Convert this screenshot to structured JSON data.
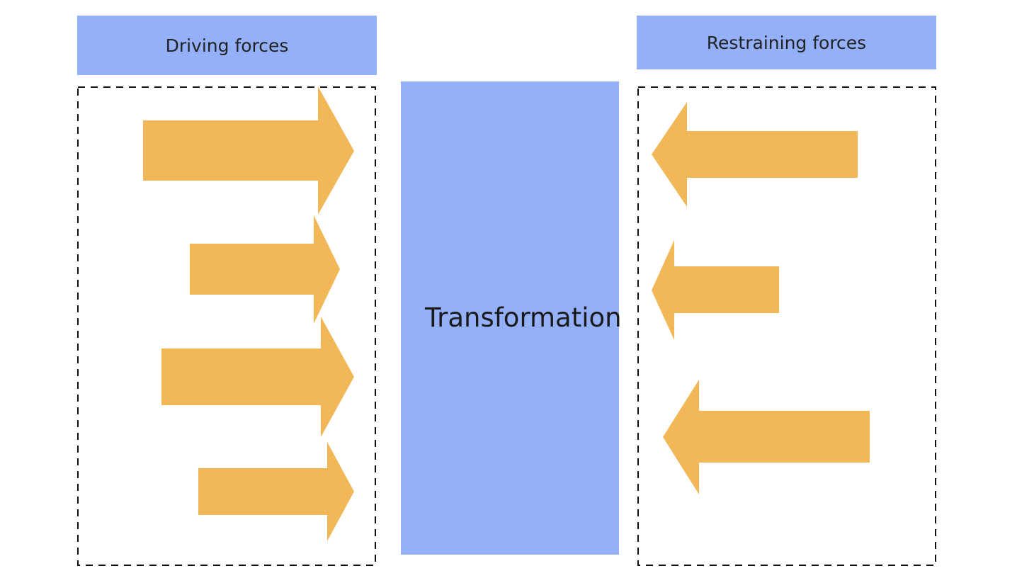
{
  "colors": {
    "box": "#94b0f8",
    "arrow": "#f2b757",
    "border": "#111111"
  },
  "driving": {
    "title": "Driving forces",
    "arrow_count": 4
  },
  "restraining": {
    "title": "Restraining forces",
    "arrow_count": 3
  },
  "center": {
    "label": "Transformation"
  }
}
